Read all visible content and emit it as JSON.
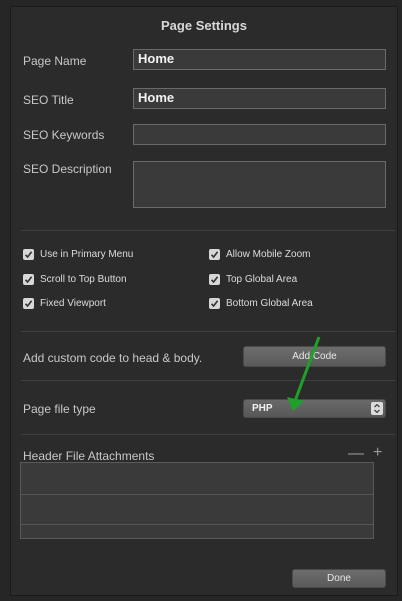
{
  "dialog": {
    "title": "Page Settings"
  },
  "fields": {
    "page_name": {
      "label": "Page Name",
      "value": "Home"
    },
    "seo_title": {
      "label": "SEO Title",
      "value": "Home"
    },
    "seo_keywords": {
      "label": "SEO Keywords",
      "value": ""
    },
    "seo_description": {
      "label": "SEO Description",
      "value": ""
    }
  },
  "checkboxes": [
    {
      "label": "Use in Primary Menu",
      "checked": true
    },
    {
      "label": "Allow Mobile Zoom",
      "checked": true
    },
    {
      "label": "Scroll to Top Button",
      "checked": true
    },
    {
      "label": "Top Global Area",
      "checked": true
    },
    {
      "label": "Fixed Viewport",
      "checked": true
    },
    {
      "label": "Bottom Global Area",
      "checked": true
    }
  ],
  "custom_code": {
    "label": "Add custom code to head & body.",
    "button": "Add Code"
  },
  "file_type": {
    "label": "Page file type",
    "value": "PHP"
  },
  "attachments": {
    "label": "Header File Attachments",
    "remove": "—",
    "add": "+"
  },
  "done_button": "Done",
  "colors": {
    "annotation_arrow": "#1fa02a"
  }
}
